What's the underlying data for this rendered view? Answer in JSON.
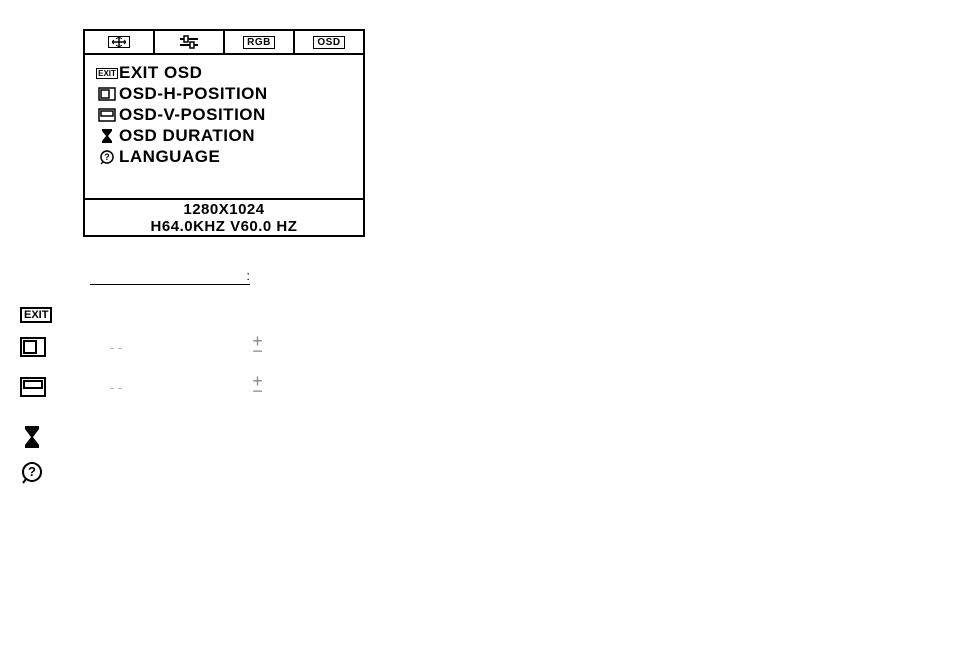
{
  "osd": {
    "tabs": {
      "position_icon": "position",
      "adjust_icon": "adjust",
      "rgb_label": "RGB",
      "osd_label": "OSD"
    },
    "menu": {
      "exit_icon_label": "EXIT",
      "exit": "EXIT OSD",
      "hpos": "OSD-H-POSITION",
      "vpos": "OSD-V-POSITION",
      "duration": "OSD DURATION",
      "language": "LANGUAGE"
    },
    "info": {
      "resolution": "1280X1024",
      "sync": "H64.0KHZ   V60.0 HZ"
    }
  },
  "legend": {
    "header_suffix": ":",
    "dash": "- -",
    "plus": "+",
    "minus": "−"
  }
}
